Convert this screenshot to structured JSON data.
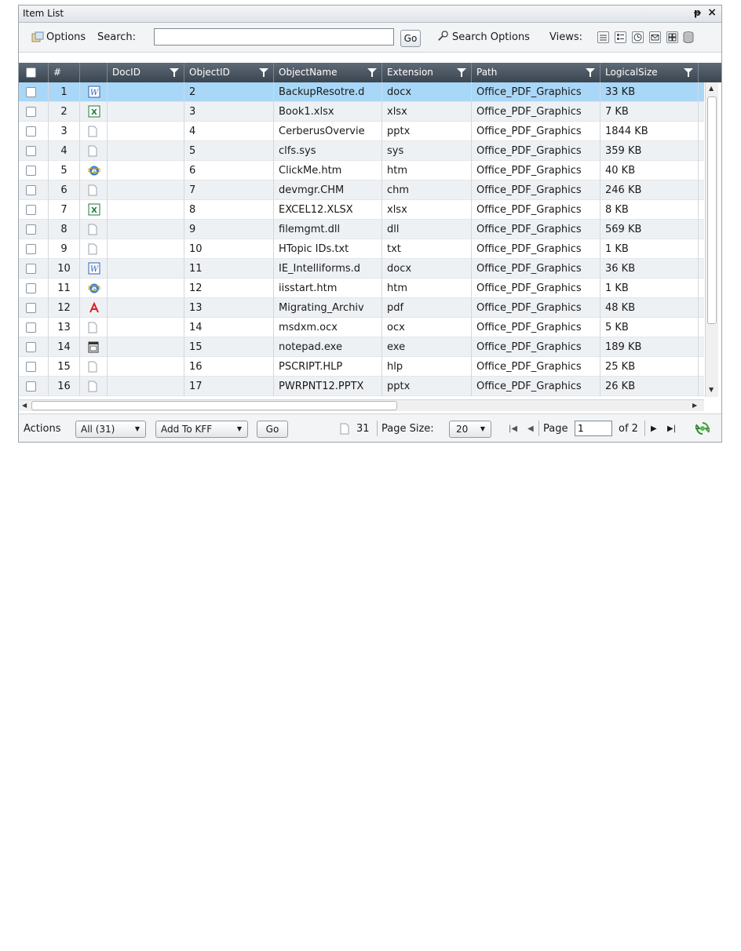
{
  "panel": {
    "title": "Item List",
    "pin_glyph": "ᵽ",
    "close_glyph": "×"
  },
  "toolbar": {
    "options_label": "Options",
    "search_label": "Search:",
    "search_value": "",
    "go_label": "Go",
    "search_options_label": "Search Options",
    "views_label": "Views:"
  },
  "columns": [
    "#",
    "DocID",
    "ObjectID",
    "ObjectName",
    "Extension",
    "Path",
    "LogicalSize"
  ],
  "rows": [
    {
      "num": "1",
      "icon": "word",
      "docid": "",
      "objectid": "2",
      "name": "BackupResotre.d",
      "ext": "docx",
      "path": "Office_PDF_Graphics",
      "size": "33 KB"
    },
    {
      "num": "2",
      "icon": "excel",
      "docid": "",
      "objectid": "3",
      "name": "Book1.xlsx",
      "ext": "xlsx",
      "path": "Office_PDF_Graphics",
      "size": "7 KB"
    },
    {
      "num": "3",
      "icon": "file",
      "docid": "",
      "objectid": "4",
      "name": "CerberusOvervie",
      "ext": "pptx",
      "path": "Office_PDF_Graphics",
      "size": "1844 KB"
    },
    {
      "num": "4",
      "icon": "file",
      "docid": "",
      "objectid": "5",
      "name": "clfs.sys",
      "ext": "sys",
      "path": "Office_PDF_Graphics",
      "size": "359 KB"
    },
    {
      "num": "5",
      "icon": "ie",
      "docid": "",
      "objectid": "6",
      "name": "ClickMe.htm",
      "ext": "htm",
      "path": "Office_PDF_Graphics",
      "size": "40 KB"
    },
    {
      "num": "6",
      "icon": "file",
      "docid": "",
      "objectid": "7",
      "name": "devmgr.CHM",
      "ext": "chm",
      "path": "Office_PDF_Graphics",
      "size": "246 KB"
    },
    {
      "num": "7",
      "icon": "excel",
      "docid": "",
      "objectid": "8",
      "name": "EXCEL12.XLSX",
      "ext": "xlsx",
      "path": "Office_PDF_Graphics",
      "size": "8 KB"
    },
    {
      "num": "8",
      "icon": "file",
      "docid": "",
      "objectid": "9",
      "name": "filemgmt.dll",
      "ext": "dll",
      "path": "Office_PDF_Graphics",
      "size": "569 KB"
    },
    {
      "num": "9",
      "icon": "file",
      "docid": "",
      "objectid": "10",
      "name": "HTopic IDs.txt",
      "ext": "txt",
      "path": "Office_PDF_Graphics",
      "size": "1 KB"
    },
    {
      "num": "10",
      "icon": "word",
      "docid": "",
      "objectid": "11",
      "name": "IE_Intelliforms.d",
      "ext": "docx",
      "path": "Office_PDF_Graphics",
      "size": "36 KB"
    },
    {
      "num": "11",
      "icon": "ie",
      "docid": "",
      "objectid": "12",
      "name": "iisstart.htm",
      "ext": "htm",
      "path": "Office_PDF_Graphics",
      "size": "1 KB"
    },
    {
      "num": "12",
      "icon": "pdf",
      "docid": "",
      "objectid": "13",
      "name": "Migrating_Archiv",
      "ext": "pdf",
      "path": "Office_PDF_Graphics",
      "size": "48 KB"
    },
    {
      "num": "13",
      "icon": "file",
      "docid": "",
      "objectid": "14",
      "name": "msdxm.ocx",
      "ext": "ocx",
      "path": "Office_PDF_Graphics",
      "size": "5 KB"
    },
    {
      "num": "14",
      "icon": "exe",
      "docid": "",
      "objectid": "15",
      "name": "notepad.exe",
      "ext": "exe",
      "path": "Office_PDF_Graphics",
      "size": "189 KB"
    },
    {
      "num": "15",
      "icon": "file",
      "docid": "",
      "objectid": "16",
      "name": "PSCRIPT.HLP",
      "ext": "hlp",
      "path": "Office_PDF_Graphics",
      "size": "25 KB"
    },
    {
      "num": "16",
      "icon": "file",
      "docid": "",
      "objectid": "17",
      "name": "PWRPNT12.PPTX",
      "ext": "pptx",
      "path": "Office_PDF_Graphics",
      "size": "26 KB"
    }
  ],
  "selected_row": 1,
  "footer": {
    "actions_label": "Actions",
    "scope_select": "All (31)",
    "action_select": "Add To KFF",
    "go_label": "Go",
    "count": "31",
    "page_size_label": "Page Size:",
    "page_size_value": "20",
    "page_label": "Page",
    "page_value": "1",
    "of_pages": "of 2"
  },
  "colors": {
    "header_bg": "#4a5561",
    "selected_row": "#a9d7f7",
    "alt_row": "#eef1f4",
    "word_blue": "#2b5fb4",
    "excel_green": "#1f7a3a",
    "pdf_red": "#d42020"
  }
}
